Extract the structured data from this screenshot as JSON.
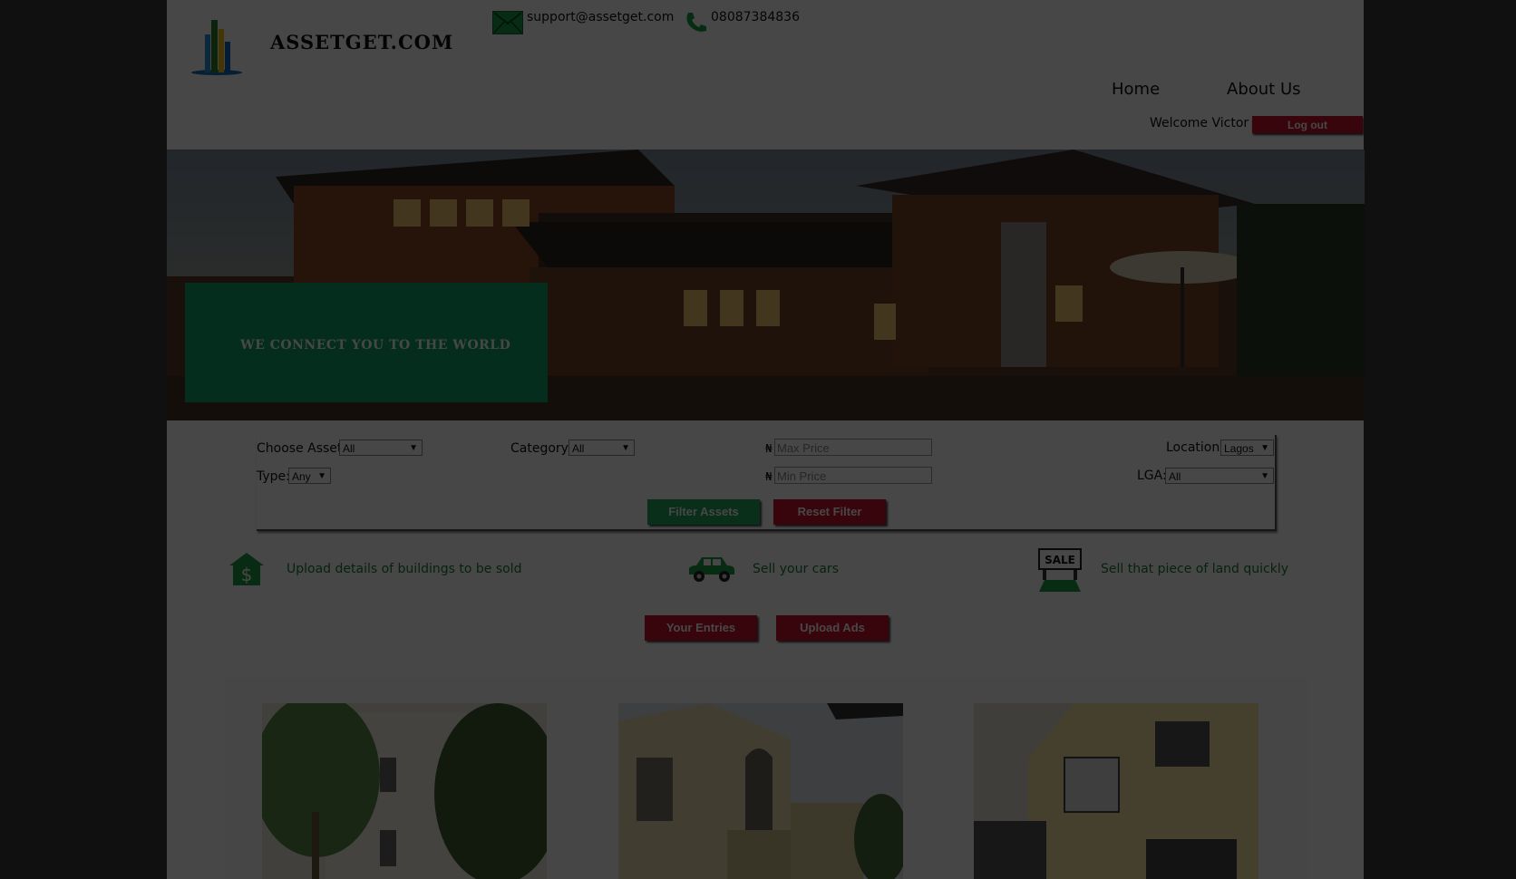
{
  "header": {
    "brand": "ASSETGET.COM",
    "email": "support@assetget.com",
    "phone": "08087384836",
    "nav": [
      {
        "label": "Home"
      },
      {
        "label": "About Us"
      }
    ],
    "welcome": "Welcome Victor",
    "logout_label": "Log out"
  },
  "hero": {
    "tagline": "WE CONNECT YOU TO THE WORLD"
  },
  "filter": {
    "choose_asset_label": "Choose Asset:",
    "choose_asset_value": "All",
    "category_label": "Category:",
    "category_value": "All",
    "type_label": "Type:",
    "type_value": "Any",
    "currency_symbol": "₦",
    "max_price_placeholder": "Max Price",
    "min_price_placeholder": "Min Price",
    "location_label": "Location:",
    "location_value": "Lagos",
    "lga_label": "LGA:",
    "lga_value": "All",
    "filter_button": "Filter Assets",
    "reset_button": "Reset Filter"
  },
  "features": [
    {
      "icon": "house-dollar-icon",
      "text": "Upload details of buildings to be sold"
    },
    {
      "icon": "car-icon",
      "text": "Sell your cars"
    },
    {
      "icon": "sale-sign-icon",
      "text": "Sell that piece of land quickly",
      "sign": "SALE"
    }
  ],
  "actions": {
    "your_entries": "Your Entries",
    "upload_ads": "Upload Ads"
  },
  "colors": {
    "accent_green": "#22a55a",
    "accent_red": "#c6142a",
    "hero_box": "#11a36a",
    "overlay": "rgba(0,0,0,0.72)"
  }
}
